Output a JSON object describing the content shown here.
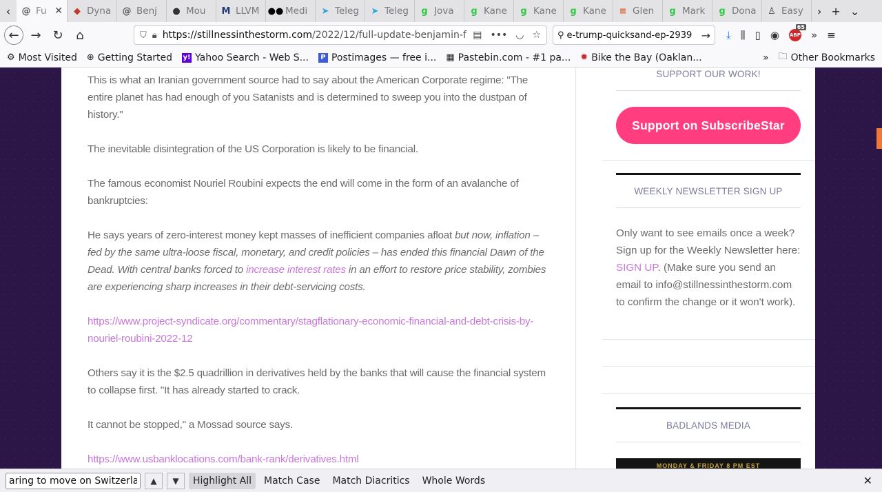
{
  "tabs": [
    {
      "title": "Fu",
      "icon": "spiral-icon",
      "color": "#555555",
      "active": true
    },
    {
      "title": "Dyna",
      "icon": "red-shield-icon",
      "color": "#c0392b"
    },
    {
      "title": "Benj",
      "icon": "spiral-icon",
      "color": "#555555"
    },
    {
      "title": "Mou",
      "icon": "dark-circle-icon",
      "color": "#333333"
    },
    {
      "title": "LLVM",
      "icon": "mps-icon",
      "color": "#1f3b73"
    },
    {
      "title": "Medi",
      "icon": "medium-icon",
      "color": "#000000"
    },
    {
      "title": "Teleg",
      "icon": "telegram-icon",
      "color": "#2aa3df"
    },
    {
      "title": "Teleg",
      "icon": "telegram-icon",
      "color": "#2aa3df"
    },
    {
      "title": "Jova",
      "icon": "g-icon",
      "color": "#2ecc40"
    },
    {
      "title": "Kane",
      "icon": "g-icon",
      "color": "#2ecc40"
    },
    {
      "title": "Kane",
      "icon": "g-icon",
      "color": "#2ecc40"
    },
    {
      "title": "Kane",
      "icon": "g-icon",
      "color": "#2ecc40"
    },
    {
      "title": "Glen",
      "icon": "flag-icon",
      "color": "#e8632b"
    },
    {
      "title": "Mark",
      "icon": "g-icon",
      "color": "#2ecc40"
    },
    {
      "title": "Dona",
      "icon": "g-icon",
      "color": "#2ecc40"
    },
    {
      "title": "Easy",
      "icon": "linux-icon",
      "color": "#444444"
    }
  ],
  "nav": {
    "url_host": "https://stillnessinthestorm.com",
    "url_path": "/2022/12/full-update-benjamin-f",
    "search_value": "e-trump-quicksand-ep-2939",
    "abp_count": "65"
  },
  "bookmarks": [
    {
      "label": "Most Visited",
      "icon": "gear-icon"
    },
    {
      "label": "Getting Started",
      "icon": "globe-icon"
    },
    {
      "label": "Yahoo Search - Web S...",
      "icon": "yahoo-icon"
    },
    {
      "label": "Postimages — free i...",
      "icon": "postimages-icon"
    },
    {
      "label": "Pastebin.com - #1 pa...",
      "icon": "pastebin-icon"
    },
    {
      "label": "Bike the Bay (Oaklan...",
      "icon": "bike-icon"
    }
  ],
  "bookmarks_other": "Other Bookmarks",
  "article": {
    "p1": "This is what an Iranian government source had to say about the American Corporate regime: \"The entire planet has had enough of you Satanists and is determined to sweep you into the dustpan of history.\"",
    "p2": "The inevitable disintegration of the US Corporation is likely to be financial.",
    "p3": "The famous economist Nouriel Roubini expects the end will come in the form of an avalanche of bankruptcies:",
    "p4_a": "He says years of zero-interest money kept masses of inefficient companies afloat ",
    "p4_b": "but now, inflation – fed by the same ultra-loose fiscal, monetary, and credit policies – has ended this financial Dawn of the Dead. With central banks forced to ",
    "p4_link": "increase interest rates",
    "p4_c": " in an effort to restore price stability, zombies are experiencing sharp increases in their debt-servicing costs.",
    "link1": "https://www.project-syndicate.org/commentary/stagflationary-economic-financial-and-debt-crisis-by-nouriel-roubini-2022-12",
    "p5": "Others say it is the $2.5 quadrillion in derivatives held by the banks that will cause the financial system to collapse first. \"It has already started to crack.",
    "p6": "It cannot be stopped,\" a Mossad source says.",
    "link2": "https://www.usbanklocations.com/bank-rank/derivatives.html"
  },
  "sidebar": {
    "support_head": "SUPPORT OUR WORK!",
    "support_button": "Support on SubscribeStar",
    "newsletter_head": "WEEKLY NEWSLETTER SIGN UP",
    "newsletter_a": "Only want to see emails once a week? Sign up for the Weekly Newsletter here: ",
    "newsletter_link": "SIGN UP",
    "newsletter_b": ". (Make sure you send an email to info@stillnessinthestorm.com to confirm the change or it won't work).",
    "badlands_head": "BADLANDS MEDIA",
    "badlands_banner": "MONDAY & FRIDAY 8 PM EST"
  },
  "findbar": {
    "value": "aring to move on Switzerland",
    "highlight_all": "Highlight All",
    "match_case": "Match Case",
    "match_diacritics": "Match Diacritics",
    "whole_words": "Whole Words"
  }
}
